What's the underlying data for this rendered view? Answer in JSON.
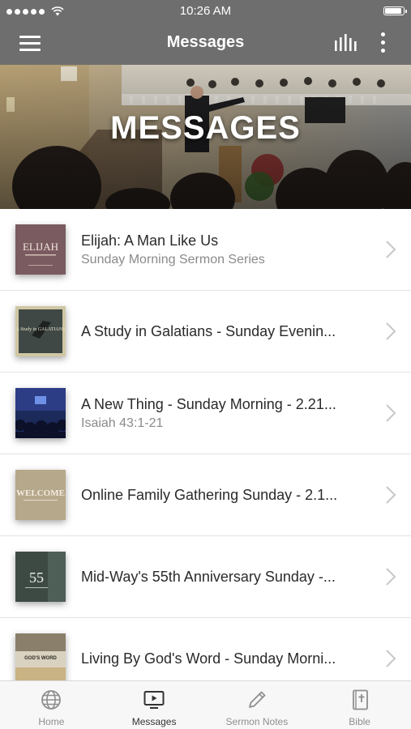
{
  "status_bar": {
    "time": "10:26 AM"
  },
  "nav": {
    "title": "Messages"
  },
  "hero": {
    "title": "MESSAGES"
  },
  "messages": [
    {
      "title": "Elijah: A Man Like Us",
      "subtitle": "Sunday Morning Sermon Series",
      "thumb_text": "ELIJAH"
    },
    {
      "title": "A Study in Galatians - Sunday Evenin...",
      "subtitle": "",
      "thumb_text": "A Study in GALATIANS"
    },
    {
      "title": "A New Thing - Sunday Morning - 2.21...",
      "subtitle": "Isaiah 43:1-21",
      "thumb_text": ""
    },
    {
      "title": "Online Family Gathering Sunday - 2.1...",
      "subtitle": "",
      "thumb_text": "WELCOME"
    },
    {
      "title": "Mid-Way's 55th Anniversary Sunday -...",
      "subtitle": "",
      "thumb_text": "55"
    },
    {
      "title": "Living By God's Word - Sunday Morni...",
      "subtitle": "",
      "thumb_text": "GOD'S WORD"
    }
  ],
  "tabs": [
    {
      "label": "Home",
      "icon": "globe-icon",
      "active": false
    },
    {
      "label": "Messages",
      "icon": "tv-icon",
      "active": true
    },
    {
      "label": "Sermon Notes",
      "icon": "pencil-icon",
      "active": false
    },
    {
      "label": "Bible",
      "icon": "bible-icon",
      "active": false
    }
  ]
}
